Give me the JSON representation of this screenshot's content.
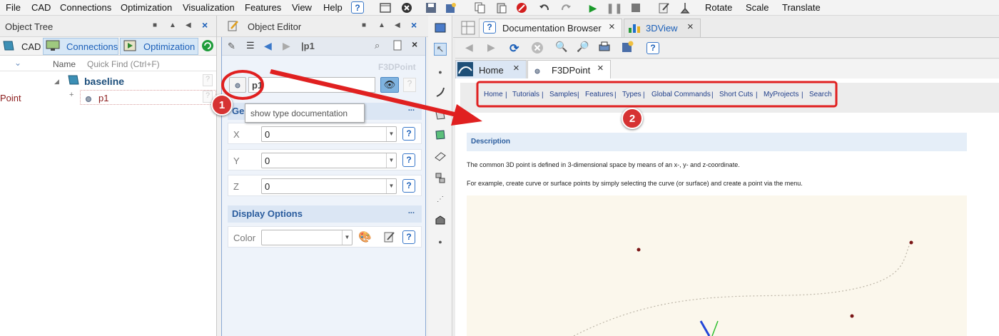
{
  "menubar": {
    "items": [
      "File",
      "CAD",
      "Connections",
      "Optimization",
      "Visualization",
      "Features",
      "View",
      "Help"
    ],
    "right_items": [
      "Rotate",
      "Scale",
      "Translate"
    ]
  },
  "object_tree": {
    "title": "Object Tree",
    "tabs": [
      "CAD",
      "Connections",
      "Optimization"
    ],
    "columns": {
      "name": "Name",
      "quick_find": "Quick Find (Ctrl+F)"
    },
    "nodes": {
      "baseline": "baseline",
      "point_label": "Point",
      "p1": "p1"
    }
  },
  "object_editor": {
    "title": "Object Editor",
    "object_name": "|p1",
    "type_label": "F3DPoint",
    "name_field": "p1",
    "tooltip": "show type documentation",
    "general_head": "Ger",
    "rows": [
      {
        "label": "X",
        "value": "0"
      },
      {
        "label": "Y",
        "value": "0"
      },
      {
        "label": "Z",
        "value": "0"
      }
    ],
    "display_options": "Display Options",
    "color_label": "Color",
    "more": "..."
  },
  "documentation": {
    "tabs": [
      "Documentation Browser",
      "3DView"
    ],
    "inner_tabs": [
      "Home",
      "F3DPoint"
    ],
    "nav_links": [
      "Home",
      "Tutorials",
      "Samples",
      "Features",
      "Types",
      "Global Commands",
      "Short Cuts",
      "MyProjects",
      "Search"
    ],
    "description_head": "Description",
    "paragraph1": "The common 3D point is defined in 3-dimensional space by means of an x-, y- and z-coordinate.",
    "paragraph2": "For example, create curve or surface points by simply selecting the curve (or surface) and create a point via the menu."
  },
  "callouts": [
    "1",
    "2"
  ],
  "colors": {
    "accent": "#d63333",
    "link": "#1f3e8a",
    "section": "#2b5d9e"
  }
}
